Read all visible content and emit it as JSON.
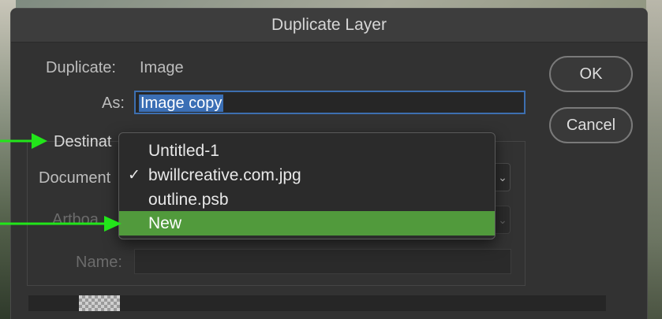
{
  "dialog": {
    "title": "Duplicate Layer",
    "duplicate_label": "Duplicate:",
    "duplicate_value": "Image",
    "as_label": "As:",
    "as_value": "Image copy",
    "destination_label": "Destinat",
    "document_label": "Document",
    "artboard_label": "Artboa",
    "name_label": "Name:",
    "ok_label": "OK",
    "cancel_label": "Cancel",
    "select_arrow": "⌄"
  },
  "document_menu": {
    "items": [
      {
        "label": "Untitled-1",
        "check": "",
        "highlighted": false
      },
      {
        "label": "bwillcreative.com.jpg",
        "check": "✓",
        "highlighted": false
      },
      {
        "label": "outline.psb",
        "check": "",
        "highlighted": false
      },
      {
        "label": "New",
        "check": "",
        "highlighted": true
      }
    ]
  },
  "colors": {
    "dialog_bg": "#323232",
    "highlight": "#519a3c",
    "arrow_green": "#22e51a",
    "selection_blue": "#3b6fb5",
    "focus_border": "#3d6fb0"
  }
}
